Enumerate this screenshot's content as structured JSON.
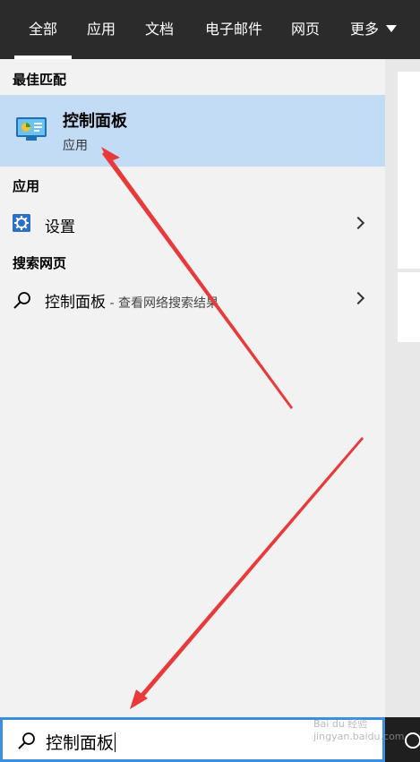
{
  "tabs": [
    {
      "label": "全部",
      "active": true
    },
    {
      "label": "应用"
    },
    {
      "label": "文档"
    },
    {
      "label": "电子邮件"
    },
    {
      "label": "网页"
    },
    {
      "label": "更多"
    }
  ],
  "sections": {
    "best_match": "最佳匹配",
    "apps": "应用",
    "web": "搜索网页"
  },
  "best_match_item": {
    "title": "控制面板",
    "subtitle": "应用"
  },
  "apps_items": [
    {
      "label": "设置",
      "icon": "gear-icon"
    }
  ],
  "web_items": [
    {
      "label": "控制面板",
      "hint": " - 查看网络搜索结果",
      "icon": "search-icon"
    }
  ],
  "search": {
    "value": "控制面板"
  },
  "watermark": "Bai du 经验 jingyan.baidu.com",
  "colors": {
    "accent": "#3a8fe0",
    "selection": "#c3dcf5",
    "arrow": "#e83a3a"
  }
}
